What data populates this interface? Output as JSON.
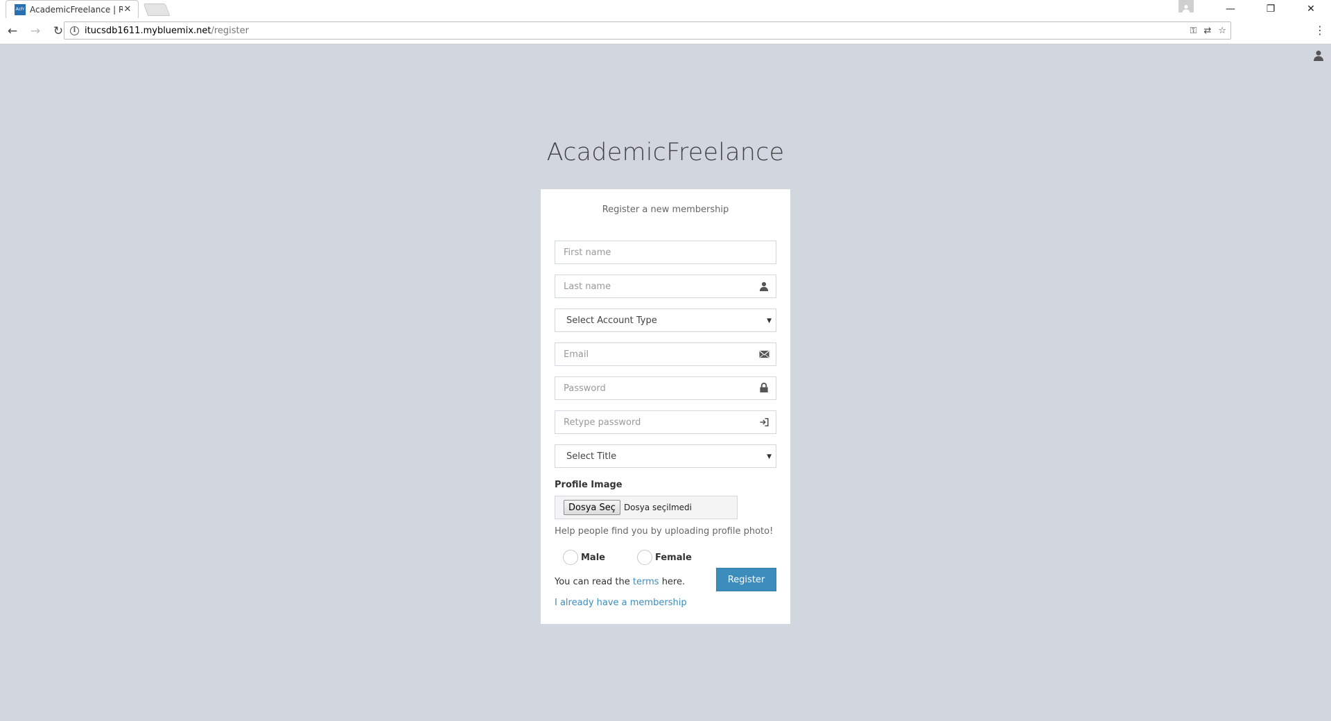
{
  "browser": {
    "tab_title": "AcademicFreelance | Reg",
    "favicon_text": "AcFr",
    "url_host": "itucsdb1611.mybluemix.net",
    "url_path": "/register"
  },
  "page": {
    "logo": "AcademicFreelance",
    "box_message": "Register a new membership",
    "first_name_placeholder": "First name",
    "last_name_placeholder": "Last name",
    "account_type_label": "Select Account Type",
    "email_placeholder": "Email",
    "password_placeholder": "Password",
    "retype_password_placeholder": "Retype password",
    "title_label": "Select Title",
    "profile_image_label": "Profile Image",
    "file_button": "Dosya Seç",
    "file_status": "Dosya seçilmedi",
    "help_text": "Help people find you by uploading profile photo!",
    "gender_male": "Male",
    "gender_female": "Female",
    "terms_prefix": "You can read the ",
    "terms_link": "terms",
    "terms_suffix": " here.",
    "register_button": "Register",
    "login_link": "I already have a membership"
  }
}
